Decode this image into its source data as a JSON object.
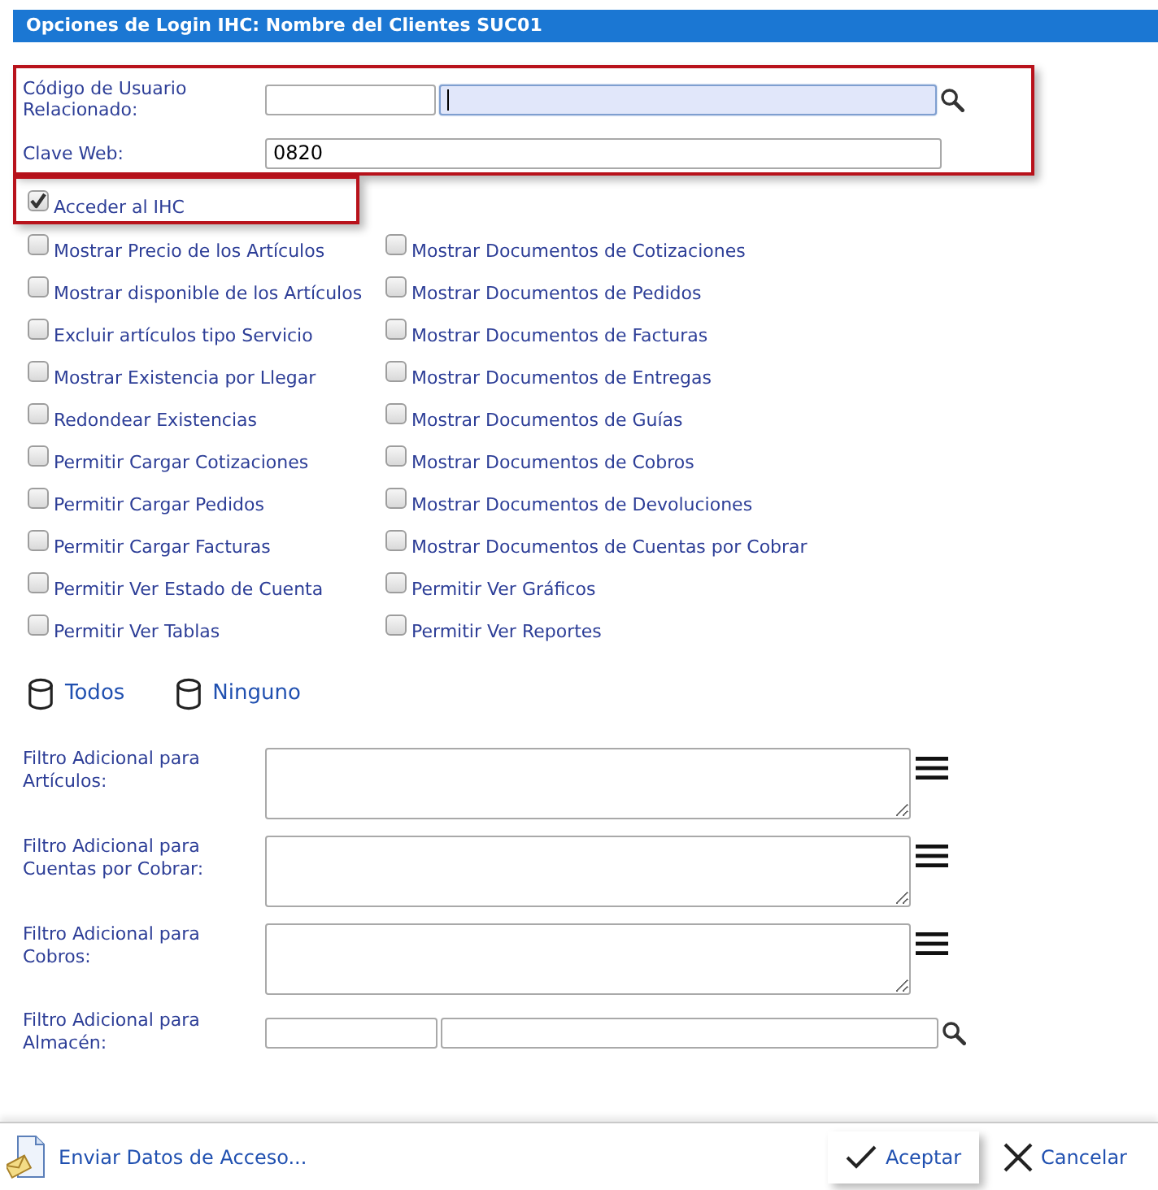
{
  "title": "Opciones de Login IHC: Nombre del Clientes SUC01",
  "login": {
    "highlighted": true,
    "rows": [
      {
        "kind": "lookup",
        "label": "Código de Usuario Relacionado:",
        "code_focused": false,
        "name_focused": true
      },
      {
        "kind": "text",
        "label": "Clave Web:",
        "value": "0820"
      }
    ]
  },
  "access": {
    "label": "Acceder al IHC",
    "checked": true,
    "highlighted": true
  },
  "options": {
    "columns": [
      [
        {
          "label": "Mostrar Precio de los Artículos",
          "checked": false
        },
        {
          "label": "Mostrar disponible de los Artículos",
          "checked": false
        },
        {
          "label": "Excluir artículos tipo Servicio",
          "checked": false
        },
        {
          "label": "Mostrar Existencia por Llegar",
          "checked": false
        },
        {
          "label": "Redondear Existencias",
          "checked": false
        },
        {
          "label": "Permitir Cargar Cotizaciones",
          "checked": false
        },
        {
          "label": "Permitir Cargar Pedidos",
          "checked": false
        },
        {
          "label": "Permitir Cargar Facturas",
          "checked": false
        },
        {
          "label": "Permitir Ver Estado de Cuenta",
          "checked": false
        },
        {
          "label": "Permitir Ver Tablas",
          "checked": false
        }
      ],
      [
        {
          "label": "Mostrar Documentos de Cotizaciones",
          "checked": false
        },
        {
          "label": "Mostrar Documentos de Pedidos",
          "checked": false
        },
        {
          "label": "Mostrar Documentos de Facturas",
          "checked": false
        },
        {
          "label": "Mostrar Documentos de Entregas",
          "checked": false
        },
        {
          "label": "Mostrar Documentos de Guías",
          "checked": false
        },
        {
          "label": "Mostrar Documentos de Cobros",
          "checked": false
        },
        {
          "label": "Mostrar Documentos de Devoluciones",
          "checked": false
        },
        {
          "label": "Mostrar Documentos de Cuentas por Cobrar",
          "checked": false
        },
        {
          "label": "Permitir Ver Gráficos",
          "checked": false
        },
        {
          "label": "Permitir Ver Reportes",
          "checked": false
        }
      ]
    ]
  },
  "bulk_actions": [
    {
      "label": "Todos"
    },
    {
      "label": "Ninguno"
    }
  ],
  "filters": [
    {
      "kind": "textarea",
      "label": "Filtro Adicional para Artículos:"
    },
    {
      "kind": "textarea",
      "label": "Filtro Adicional para Cuentas por Cobrar:"
    },
    {
      "kind": "textarea",
      "label": "Filtro Adicional para Cobros:"
    },
    {
      "kind": "lookup",
      "label": "Filtro Adicional para Almacén:",
      "code_focused": false,
      "name_focused": false
    }
  ],
  "footer": {
    "send_link": {
      "label": "Enviar Datos de Acceso..."
    },
    "buttons": [
      {
        "kind": "accept",
        "label": "Aceptar",
        "highlighted": true
      },
      {
        "kind": "cancel",
        "label": "Cancelar",
        "highlighted": false
      }
    ]
  }
}
